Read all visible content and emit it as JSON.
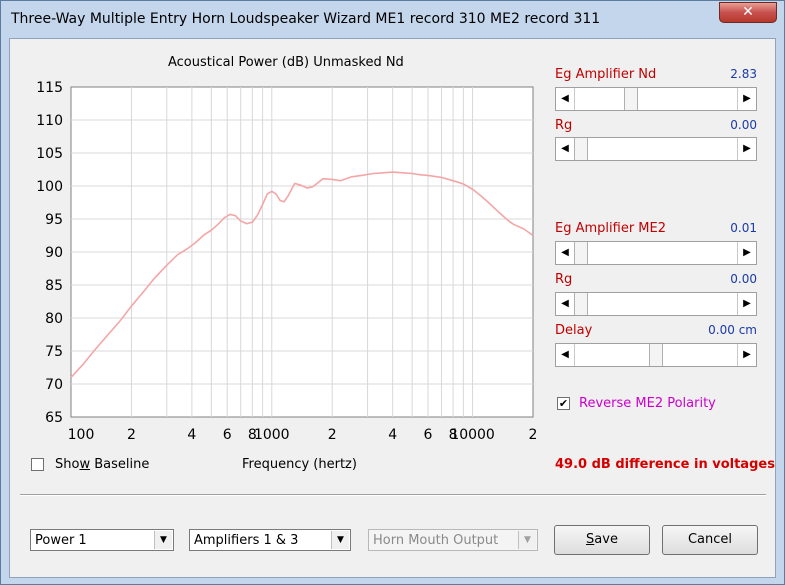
{
  "window": {
    "title": "Three-Way Multiple Entry Horn Loudspeaker Wizard    ME1 record 310    ME2 record 311",
    "close_glyph": "✕"
  },
  "chart_data": {
    "type": "line",
    "title": "Acoustical Power (dB)   Unmasked   Nd",
    "xlabel": "Frequency (hertz)",
    "ylabel": "",
    "x_scale": "log",
    "xlim": [
      100,
      20000
    ],
    "ylim": [
      65,
      115
    ],
    "y_ticks": [
      65,
      70,
      75,
      80,
      85,
      90,
      95,
      100,
      105,
      110,
      115
    ],
    "x_tick_labels": [
      "100",
      "2",
      "4",
      "6",
      "8",
      "1000",
      "2",
      "4",
      "6",
      "8",
      "10000",
      "2"
    ],
    "grid": true,
    "series": [
      {
        "color": "#f4a6a6",
        "x": [
          100,
          115,
          130,
          150,
          175,
          200,
          230,
          260,
          300,
          340,
          380,
          420,
          460,
          500,
          540,
          580,
          620,
          660,
          700,
          750,
          800,
          850,
          900,
          950,
          1000,
          1050,
          1100,
          1150,
          1200,
          1300,
          1400,
          1500,
          1600,
          1800,
          2000,
          2200,
          2500,
          2800,
          3200,
          3600,
          4000,
          4500,
          5000,
          5500,
          6000,
          7000,
          8000,
          9000,
          10000,
          11000,
          12000,
          13000,
          14000,
          15000,
          16000,
          18000,
          20000
        ],
        "y": [
          71,
          73,
          75,
          77.2,
          79.5,
          81.8,
          84,
          86,
          88,
          89.6,
          90.5,
          91.5,
          92.6,
          93.3,
          94.2,
          95.2,
          95.7,
          95.5,
          94.7,
          94.3,
          94.5,
          95.6,
          97.2,
          98.8,
          99.2,
          98.8,
          97.8,
          97.6,
          98.4,
          100.4,
          100.1,
          99.7,
          99.9,
          101.1,
          101.0,
          100.8,
          101.4,
          101.6,
          101.9,
          102.0,
          102.1,
          102.0,
          101.9,
          101.7,
          101.6,
          101.3,
          100.8,
          100.3,
          99.5,
          98.5,
          97.5,
          96.5,
          95.6,
          94.8,
          94.2,
          93.5,
          92.5
        ]
      }
    ]
  },
  "controls": {
    "eg_amp_nd": {
      "label": "Eg  Amplifier  Nd",
      "value": "2.83",
      "level": 0.33
    },
    "rg1": {
      "label": "Rg",
      "value": "0.00",
      "level": 0.0
    },
    "eg_amp_me2": {
      "label": "Eg  Amplifier  ME2",
      "value": "0.01",
      "level": 0.0
    },
    "rg2": {
      "label": "Rg",
      "value": "0.00",
      "level": 0.0
    },
    "delay": {
      "label": "Delay",
      "value": "0.00 cm",
      "level": 0.5
    },
    "reverse_polarity": {
      "label": "Reverse ME2 Polarity",
      "checked": true,
      "check_glyph": "✔"
    }
  },
  "show_baseline": {
    "label_pre": "Sho",
    "label_u": "w",
    "label_post": " Baseline",
    "checked": false
  },
  "diff_text": "49.0 dB difference in voltages",
  "combos": {
    "power": "Power 1",
    "amplifiers": "Amplifiers 1 & 3",
    "output": "Horn Mouth Output"
  },
  "buttons": {
    "save_u": "S",
    "save_rest": "ave",
    "cancel": "Cancel"
  },
  "arrow_glyphs": {
    "left": "◀",
    "right": "▶",
    "down": "▼"
  }
}
